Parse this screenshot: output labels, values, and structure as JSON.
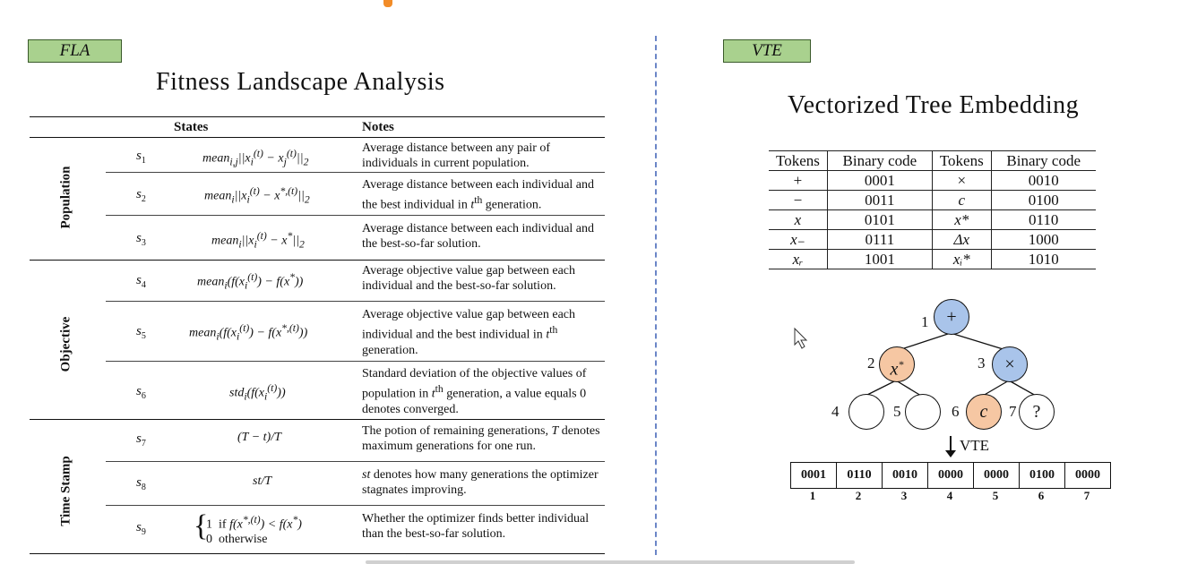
{
  "fla": {
    "tag": "FLA",
    "title": "Fitness Landscape Analysis",
    "header_states": "States",
    "header_notes": "Notes",
    "groups": [
      "Population",
      "Objective",
      "Time Stamp"
    ],
    "rows": [
      {
        "sym": "s1",
        "formula": "mean_{i,j}||x_i^{(t)} − x_j^{(t)}||_2",
        "note": "Average distance between any pair of individuals in current population."
      },
      {
        "sym": "s2",
        "formula": "mean_i||x_i^{(t)} − x^{*,(t)}||_2",
        "note": "Average distance between each individual and the best individual in tᵗʰ generation."
      },
      {
        "sym": "s3",
        "formula": "mean_i||x_i^{(t)} − x^*||_2",
        "note": "Average distance between each individual and the best-so-far solution."
      },
      {
        "sym": "s4",
        "formula": "mean_i(f(x_i^{(t)}) − f(x^*))",
        "note": "Average objective value gap between each individual and the best-so-far solution."
      },
      {
        "sym": "s5",
        "formula": "mean_i(f(x_i^{(t)}) − f(x^{*,(t)}))",
        "note": "Average objective value gap between each individual and the best individual in tᵗʰ generation."
      },
      {
        "sym": "s6",
        "formula": "std_i(f(x_i^{(t)}))",
        "note": "Standard deviation of the objective values of population in tᵗʰ generation, a value equals 0 denotes converged."
      },
      {
        "sym": "s7",
        "formula": "(T − t)/T",
        "note": "The potion of remaining generations, T denotes maximum generations for one run."
      },
      {
        "sym": "s8",
        "formula": "st/T",
        "note": "st denotes how many generations the optimizer stagnates improving."
      },
      {
        "sym": "s9",
        "formula_line1": "1  if f(x^{*,(t)}) < f(x^*)",
        "formula_line2": "0  otherwise",
        "note": "Whether the optimizer finds better individual than the best-so-far solution."
      }
    ]
  },
  "vte": {
    "tag": "VTE",
    "title": "Vectorized Tree Embedding",
    "table_headers": [
      "Tokens",
      "Binary code",
      "Tokens",
      "Binary code"
    ],
    "table_rows": [
      [
        "+",
        "0001",
        "×",
        "0010"
      ],
      [
        "−",
        "0011",
        "c",
        "0100"
      ],
      [
        "x",
        "0101",
        "x*",
        "0110"
      ],
      [
        "x₋",
        "0111",
        "Δx",
        "1000"
      ],
      [
        "xᵣ",
        "1001",
        "xᵢ*",
        "1010"
      ]
    ],
    "tree": {
      "nodes": [
        {
          "id": "1",
          "symbol": "+",
          "color": "#a9c4ea"
        },
        {
          "id": "2",
          "symbol": "x*",
          "color": "#f6c7a3"
        },
        {
          "id": "3",
          "symbol": "×",
          "color": "#a9c4ea"
        },
        {
          "id": "4",
          "symbol": "",
          "color": "#ffffff"
        },
        {
          "id": "5",
          "symbol": "",
          "color": "#ffffff"
        },
        {
          "id": "6",
          "symbol": "c",
          "color": "#f6c7a3"
        },
        {
          "id": "7",
          "symbol": "?",
          "color": "#ffffff"
        }
      ],
      "arrow_label": "VTE"
    },
    "codes": [
      "0001",
      "0110",
      "0010",
      "0000",
      "0000",
      "0100",
      "0000"
    ],
    "code_indices": [
      "1",
      "2",
      "3",
      "4",
      "5",
      "6",
      "7"
    ]
  },
  "colors": {
    "tag_fill": "#a9d18e",
    "divider": "#6b86c7",
    "blue_node": "#a9c4ea",
    "orange_node": "#f6c7a3"
  }
}
